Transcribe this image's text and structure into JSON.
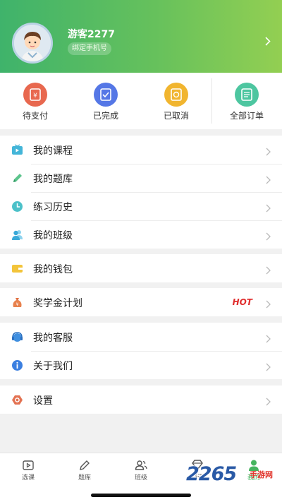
{
  "profile": {
    "user_name": "游客2277",
    "bind_phone": "绑定手机号"
  },
  "orders": [
    {
      "label": "待支付",
      "color": "#e8684f"
    },
    {
      "label": "已完成",
      "color": "#5577e6"
    },
    {
      "label": "已取消",
      "color": "#f1b52f"
    },
    {
      "label": "全部订单",
      "color": "#4dc6a0"
    }
  ],
  "menu": {
    "my_courses": "我的课程",
    "my_question_bank": "我的题库",
    "practice_history": "练习历史",
    "my_class": "我的班级",
    "my_wallet": "我的钱包",
    "scholarship_plan": "奖学金计划",
    "hot_badge": "HOT",
    "customer_service": "我的客服",
    "about_us": "关于我们",
    "settings": "设置"
  },
  "tabbar": {
    "tabs": [
      {
        "label": "选课"
      },
      {
        "label": "题库"
      },
      {
        "label": "班级"
      },
      {
        "label": "资讯"
      },
      {
        "label": "我的"
      }
    ],
    "active": "我的"
  },
  "watermark": {
    "digits": "2265",
    "text": "手游网",
    "domain": ".com"
  },
  "colors": {
    "brand_green": "#45b45e",
    "hot_red": "#e02e2e"
  }
}
